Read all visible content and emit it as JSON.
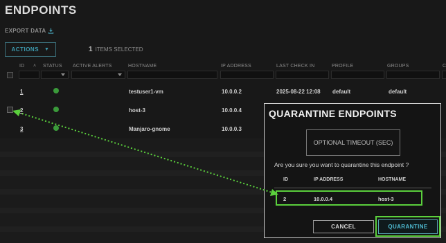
{
  "page": {
    "title": "ENDPOINTS"
  },
  "toolbar": {
    "export_label": "EXPORT DATA",
    "actions_label": "ACTIONS",
    "selected_count": "1",
    "selected_label": "ITEMS SELECTED"
  },
  "table": {
    "columns": [
      "ID",
      "STATUS",
      "ACTIVE ALERTS",
      "HOSTNAME",
      "IP ADDRESS",
      "LAST CHECK IN",
      "PROFILE",
      "GROUPS",
      "C"
    ],
    "rows": [
      {
        "id": "1",
        "status": "online",
        "hostname": "testuser1-vm",
        "ip": "10.0.0.2",
        "last_check_in": "2025-08-22 12:08",
        "profile": "default",
        "groups": "default"
      },
      {
        "id": "2",
        "status": "online",
        "hostname": "host-3",
        "ip": "10.0.0.4"
      },
      {
        "id": "3",
        "status": "online",
        "hostname": "Manjaro-gnome",
        "ip": "10.0.0.3"
      }
    ]
  },
  "modal": {
    "title": "QUARANTINE ENDPOINTS",
    "timeout_placeholder": "OPTIONAL TIMEOUT (SEC)",
    "confirm_text": "Are you sure you want to quarantine this endpoint ?",
    "columns": [
      "ID",
      "IP ADDRESS",
      "HOSTNAME"
    ],
    "row": {
      "id": "2",
      "ip": "10.0.0.4",
      "hostname": "host-3"
    },
    "cancel_label": "CANCEL",
    "confirm_label": "QUARANTINE"
  },
  "colors": {
    "accent": "#4fbcd3",
    "highlight": "#5bd03d",
    "status_online": "#3a9a3a"
  }
}
